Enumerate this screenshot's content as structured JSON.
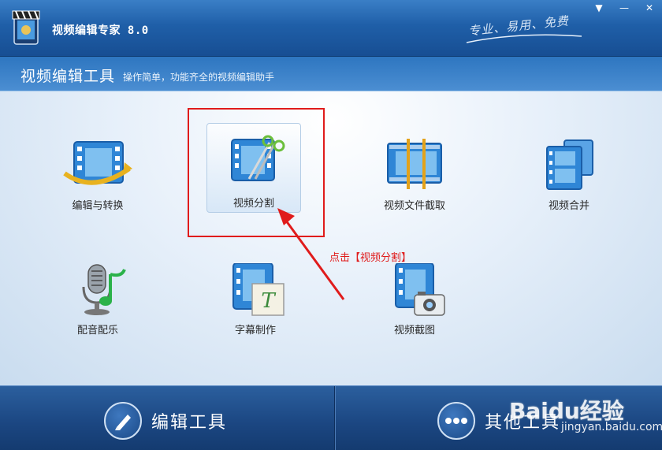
{
  "window": {
    "title": "视频编辑专家 8.0",
    "slogan": "专业、易用、免费",
    "menu_icon": "▼",
    "minimize_icon": "—",
    "close_icon": "✕"
  },
  "subheader": {
    "title": "视频编辑工具",
    "description": "操作简单，功能齐全的视频编辑助手"
  },
  "tools": [
    {
      "label": "编辑与转换",
      "icon": "film-convert-icon"
    },
    {
      "label": "视频分割",
      "icon": "film-scissors-icon"
    },
    {
      "label": "视频文件截取",
      "icon": "film-cut-icon"
    },
    {
      "label": "视频合并",
      "icon": "film-merge-icon"
    },
    {
      "label": "配音配乐",
      "icon": "microphone-music-icon"
    },
    {
      "label": "字幕制作",
      "icon": "film-subtitle-icon"
    },
    {
      "label": "视频截图",
      "icon": "film-camera-icon"
    }
  ],
  "annotation": {
    "text": "点击【视频分割】",
    "color": "#e01b1b"
  },
  "bottom_tabs": [
    {
      "label": "编辑工具",
      "icon": "pencil-icon"
    },
    {
      "label": "其他工具",
      "icon": "more-dots-icon"
    }
  ],
  "watermark": {
    "logo": "Baidu经验",
    "url": "jingyan.baidu.com"
  },
  "colors": {
    "accent": "#1f5fa8",
    "film_blue": "#2f86d6",
    "highlight_red": "#e01b1b"
  }
}
